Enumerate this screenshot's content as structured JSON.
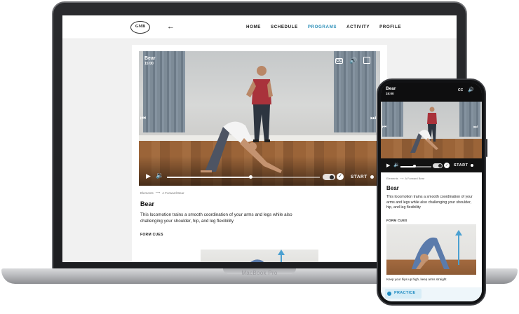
{
  "device": {
    "laptop_model": "MacBook Pro"
  },
  "site": {
    "logo_text": "GMB",
    "back_icon": "arrow-left-icon",
    "nav": [
      {
        "label": "HOME",
        "active": false
      },
      {
        "label": "SCHEDULE",
        "active": false
      },
      {
        "label": "PROGRAMS",
        "active": true
      },
      {
        "label": "ACTIVITY",
        "active": false
      },
      {
        "label": "PROFILE",
        "active": false
      }
    ],
    "accent_color": "#2c8fb8"
  },
  "video": {
    "title": "Bear",
    "time": "15:00",
    "cc_label": "CC",
    "start_label": "START",
    "progress": 0.55
  },
  "breadcrumb": {
    "parent": "Elements",
    "current": "A Forward Bear"
  },
  "exercise": {
    "title": "Bear",
    "description": "This locomotion trains a smooth coordination of your arms and legs while also challenging your shoulder, hip, and leg flexibility",
    "form_cues_label": "FORM CUES",
    "cue_text": "Keep your hips up high, keep arms straight"
  },
  "phone": {
    "video_title": "Bear",
    "video_time": "15:00",
    "cc_label": "CC",
    "start_label": "START",
    "progress": 0.45,
    "practice_label": "PRACTICE"
  }
}
